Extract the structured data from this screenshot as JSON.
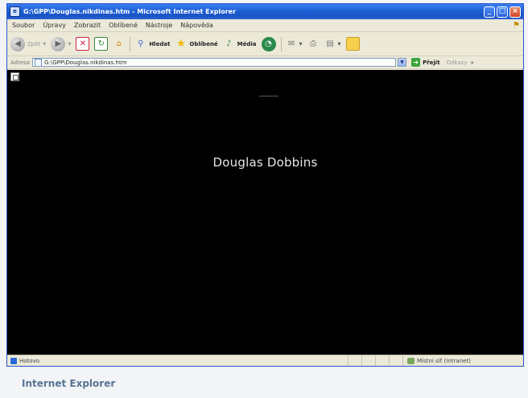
{
  "window": {
    "title": "G:\\GPP\\Douglas.nikdinas.htm - Microsoft Internet Explorer",
    "app_icon": "ie-page-icon",
    "minimize_glyph": "_",
    "maximize_glyph": "□",
    "close_glyph": "×"
  },
  "menu": {
    "items": [
      "Soubor",
      "Úpravy",
      "Zobrazit",
      "Oblíbené",
      "Nástroje",
      "Nápověda"
    ]
  },
  "toolbar": {
    "back_label": "Zpět",
    "search_label": "Hledat",
    "favorites_label": "Oblíbené",
    "media_label": "Média"
  },
  "address": {
    "label": "Adresa",
    "value": "G:\\GPP\\Douglas.nikdinas.htm",
    "go_label": "Přejít",
    "links_label": "Odkazy"
  },
  "content": {
    "heading": "Douglas Dobbins",
    "background": "#000000",
    "text_color": "#e6e6e6"
  },
  "status": {
    "text": "Hotovo",
    "zone": "Místní síť (Intranet)"
  },
  "caption": {
    "text": "Internet Explorer",
    "color": "#5a7592"
  }
}
